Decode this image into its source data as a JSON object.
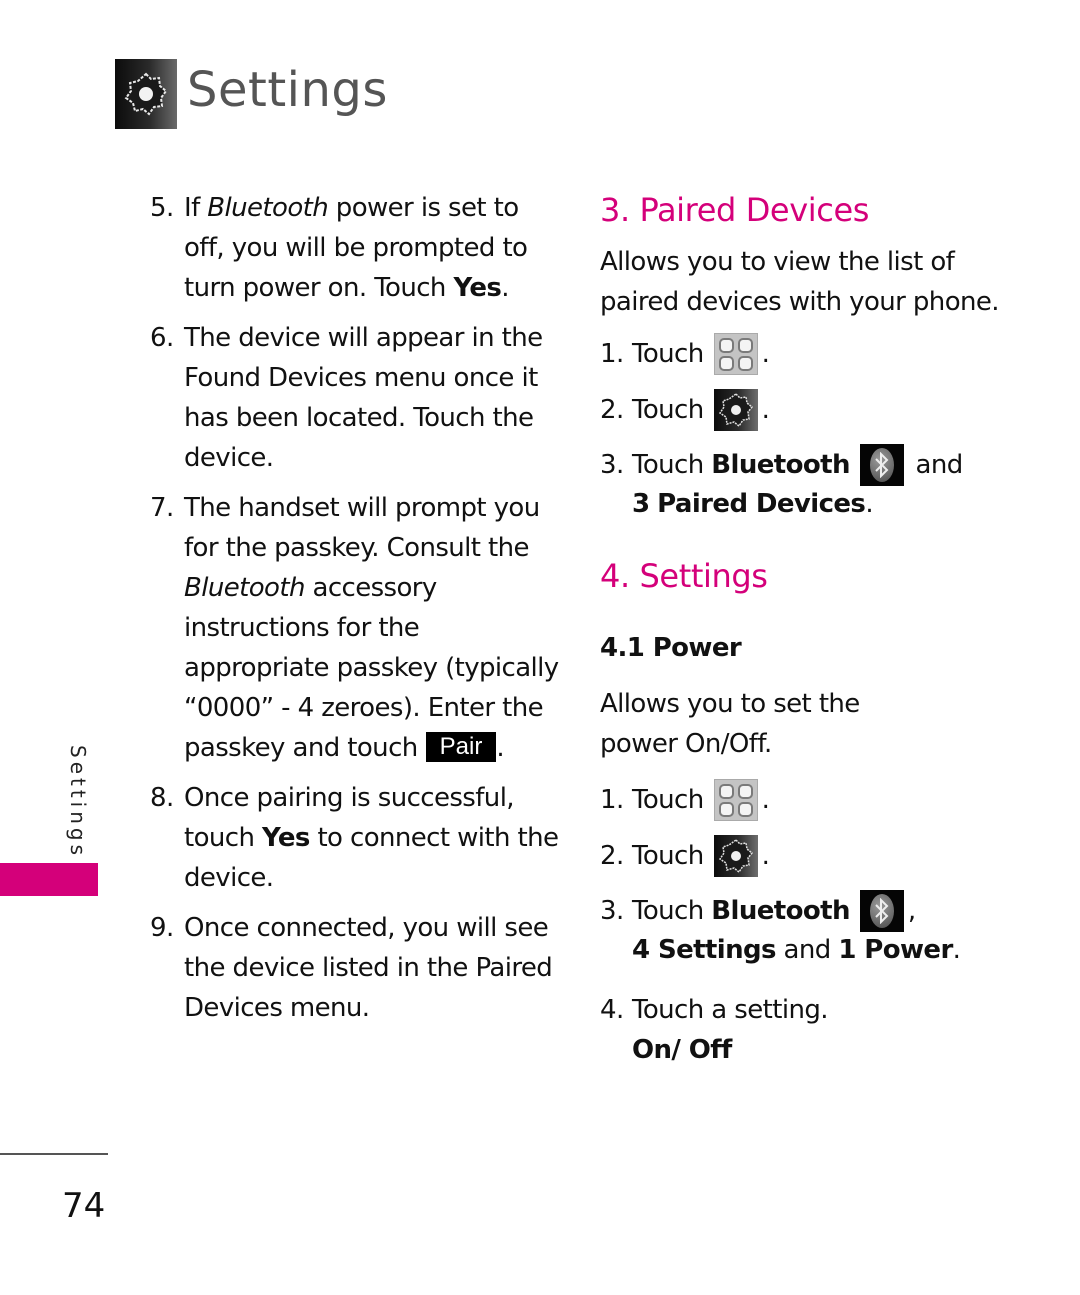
{
  "header": {
    "title": "Settings",
    "icon": "settings-gear-icon"
  },
  "side_tab": {
    "label": "Settings",
    "accent_color": "#d4007a"
  },
  "page_number": "74",
  "left_column": {
    "steps": [
      {
        "num": "5.",
        "parts": [
          "If ",
          "Bluetooth",
          " power is set to off, you will be prompted to turn power on. Touch ",
          "Yes",
          "."
        ]
      },
      {
        "num": "6.",
        "text": "The device will appear in the Found Devices menu once it has been located. Touch the device."
      },
      {
        "num": "7.",
        "parts": [
          "The handset will prompt you for the passkey. Consult the ",
          "Bluetooth",
          " accessory instructions for the appropriate passkey (typically “0000” - 4 zeroes). Enter the passkey and touch",
          "."
        ],
        "button_label": "Pair"
      },
      {
        "num": "8.",
        "parts": [
          "Once pairing is successful, touch ",
          "Yes",
          " to connect with the device."
        ]
      },
      {
        "num": "9.",
        "text": "Once connected, you will see the device listed in the Paired Devices menu."
      }
    ]
  },
  "right_column": {
    "paired_devices": {
      "heading": "3. Paired Devices",
      "description": "Allows you to view the list of paired devices with your phone.",
      "steps": [
        {
          "num": "1.",
          "text": "Touch",
          "icon": "menu-grid-icon",
          "after": "."
        },
        {
          "num": "2.",
          "text": "Touch",
          "icon": "settings-gear-icon",
          "after": "."
        },
        {
          "num": "3.",
          "text": "Touch ",
          "bold": "Bluetooth",
          "icon": "bluetooth-icon",
          "after": " and",
          "line2_num": "3",
          "line2_bold": "Paired Devices",
          "line2_after": "."
        }
      ]
    },
    "settings": {
      "heading": "4. Settings",
      "sub_heading": "4.1 Power",
      "description": "Allows you to set the power On/Off.",
      "steps": [
        {
          "num": "1.",
          "text": "Touch",
          "icon": "menu-grid-icon",
          "after": "."
        },
        {
          "num": "2.",
          "text": "Touch",
          "icon": "settings-gear-icon",
          "after": "."
        },
        {
          "num": "3.",
          "text": "Touch ",
          "bold": "Bluetooth",
          "icon": "bluetooth-icon",
          "after": ",",
          "line2_a": "4 Settings",
          "line2_b": " and ",
          "line2_c": "1 Power",
          "line2_d": "."
        },
        {
          "num": "4.",
          "text": "Touch a setting.",
          "line2_bold": "On/ Off"
        }
      ]
    },
    "heading_color": "#d4007a"
  }
}
